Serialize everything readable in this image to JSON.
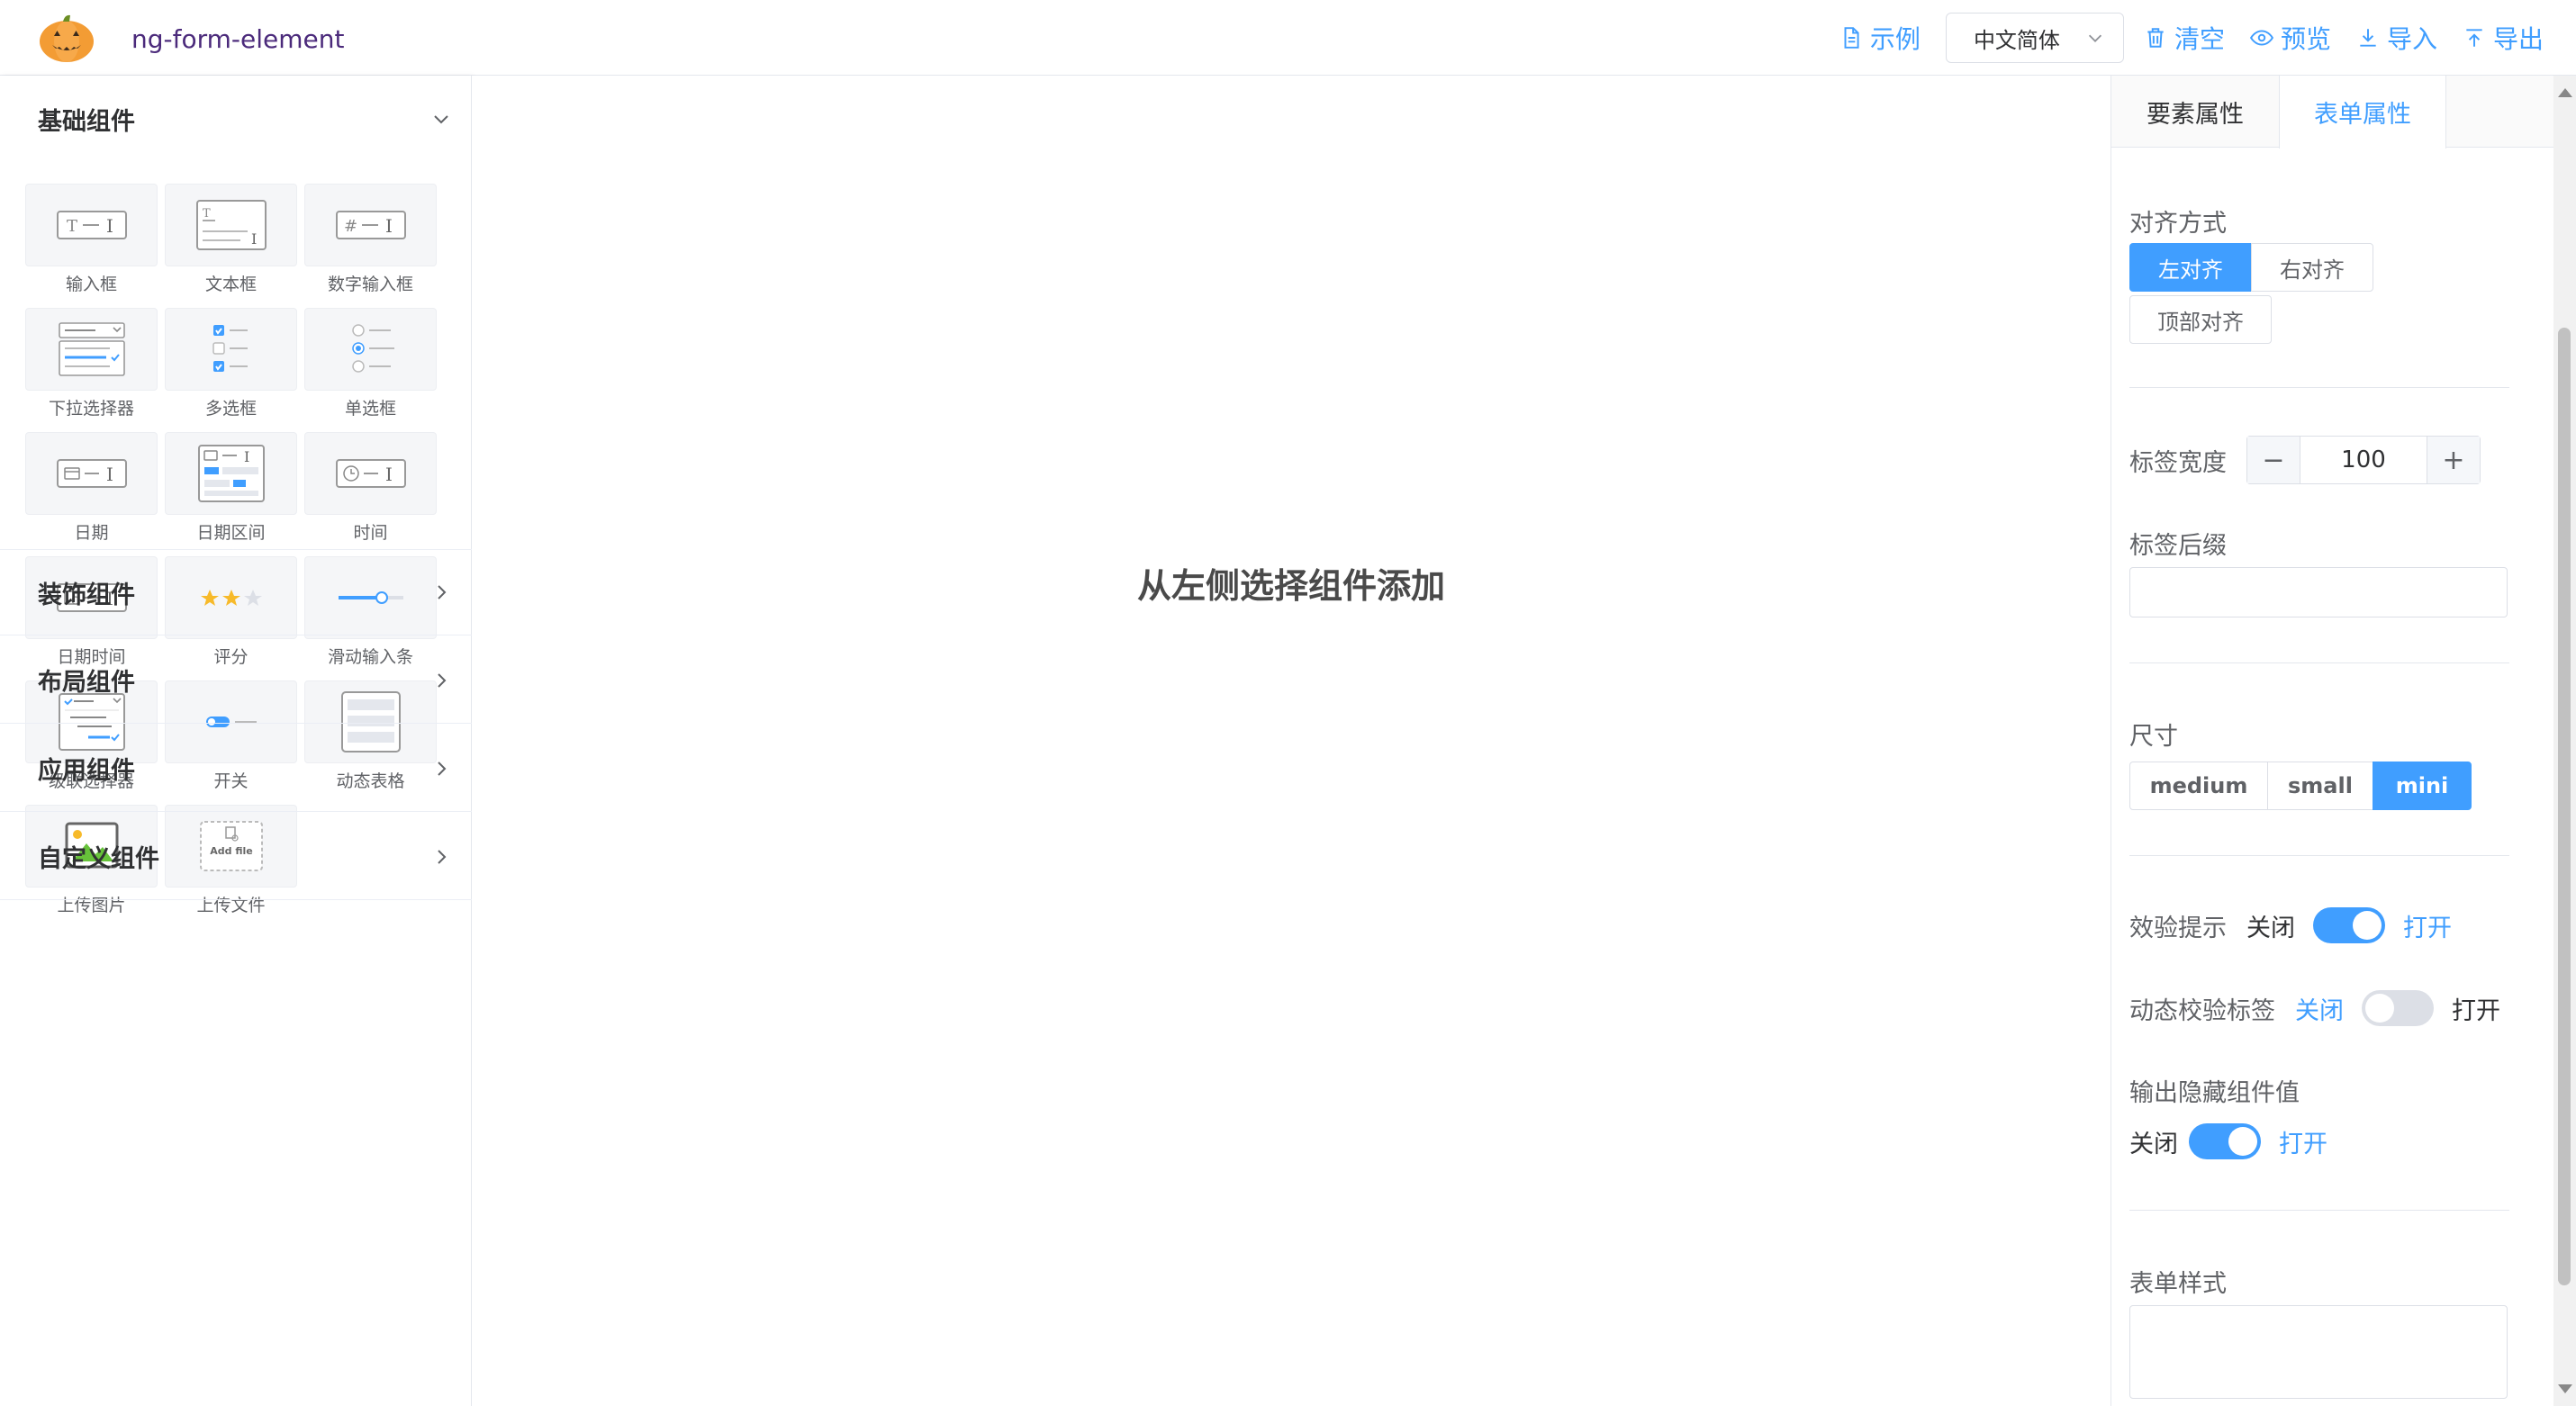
{
  "header": {
    "app_name": "ng-form-element",
    "actions": {
      "example": "示例",
      "language": "中文简体",
      "clear": "清空",
      "preview": "预览",
      "import": "导入",
      "export": "导出"
    },
    "accent_color": "#409eff"
  },
  "sidebar": {
    "basic_title": "基础组件",
    "components": [
      "输入框",
      "文本框",
      "数字输入框",
      "下拉选择器",
      "多选框",
      "单选框",
      "日期",
      "日期区间",
      "时间",
      "日期时间",
      "评分",
      "滑动输入条",
      "级联选择器",
      "开关",
      "动态表格",
      "上传图片",
      "上传文件"
    ],
    "upload_file_icon_text": "Add file",
    "groups": [
      "装饰组件",
      "布局组件",
      "应用组件",
      "自定义组件"
    ]
  },
  "canvas": {
    "empty_tip": "从左侧选择组件添加"
  },
  "panel": {
    "tabs": [
      "要素属性",
      "表单属性"
    ],
    "active_tab": 1,
    "align": {
      "label": "对齐方式",
      "options": [
        "左对齐",
        "右对齐",
        "顶部对齐"
      ],
      "selected": "左对齐"
    },
    "label_width": {
      "label": "标签宽度",
      "value": "100",
      "minus": "−",
      "plus": "+"
    },
    "label_suffix": {
      "label": "标签后缀",
      "value": ""
    },
    "size": {
      "label": "尺寸",
      "options": [
        "medium",
        "small",
        "mini"
      ],
      "selected": "mini"
    },
    "validate_hint": {
      "label": "效验提示",
      "off": "关闭",
      "on": "打开",
      "state": true
    },
    "dynamic_validate_label": {
      "label": "动态校验标签",
      "off": "关闭",
      "on": "打开",
      "state": false
    },
    "output_hidden": {
      "label": "输出隐藏组件值",
      "off": "关闭",
      "on": "打开",
      "state": true
    },
    "form_style": {
      "label": "表单样式",
      "value": ""
    }
  }
}
